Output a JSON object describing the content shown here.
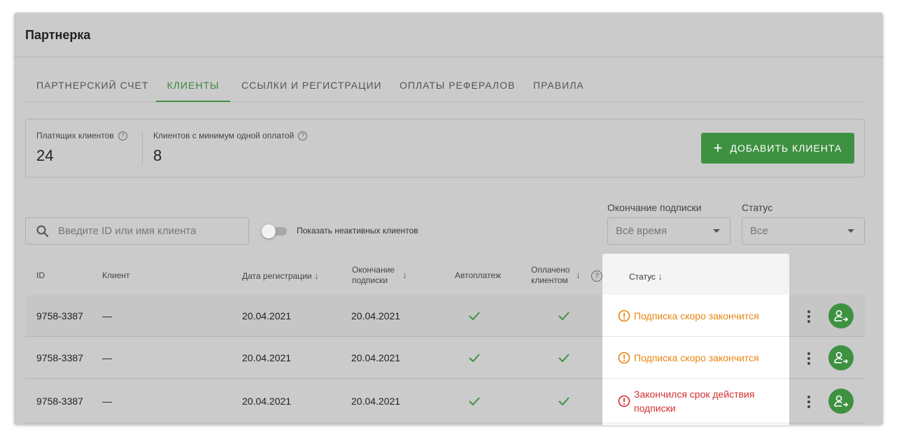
{
  "page": {
    "title": "Партнерка"
  },
  "tabs": [
    {
      "label": "ПАРТНЕРСКИЙ СЧЕТ",
      "active": false
    },
    {
      "label": "КЛИЕНТЫ",
      "active": true
    },
    {
      "label": "ССЫЛКИ И РЕГИСТРАЦИИ",
      "active": false
    },
    {
      "label": "ОПЛАТЫ РЕФЕРАЛОВ",
      "active": false
    },
    {
      "label": "ПРАВИЛА",
      "active": false
    }
  ],
  "stats": {
    "paying": {
      "label": "Платящих клиентов",
      "value": "24"
    },
    "one_payment": {
      "label": "Клиентов с минимум одной оплатой",
      "value": "8"
    }
  },
  "actions": {
    "add_client": "ДОБАВИТЬ КЛИЕНТА"
  },
  "filters": {
    "search_placeholder": "Введите ID или имя клиента",
    "toggle_label": "Показать неактивных клиентов",
    "subscription_end": {
      "label": "Окончание подписки",
      "value": "Всё время"
    },
    "status": {
      "label": "Статус",
      "value": "Все"
    }
  },
  "table": {
    "headers": {
      "id": "ID",
      "client": "Клиент",
      "reg_date": "Дата регистрации",
      "sub_end_1": "Окончание",
      "sub_end_2": "подписки",
      "autopay": "Автоплатеж",
      "paid_1": "Оплачено",
      "paid_2": "клиентом",
      "status": "Статус"
    },
    "rows": [
      {
        "id": "9758-3387",
        "client": "—",
        "reg_date": "20.04.2021",
        "sub_end": "20.04.2021",
        "autopay": true,
        "paid": true,
        "status_1": "Подписка скоро закончится",
        "status_2": "",
        "status_kind": "warning"
      },
      {
        "id": "9758-3387",
        "client": "—",
        "reg_date": "20.04.2021",
        "sub_end": "20.04.2021",
        "autopay": true,
        "paid": true,
        "status_1": "Подписка скоро закончится",
        "status_2": "",
        "status_kind": "warning"
      },
      {
        "id": "9758-3387",
        "client": "—",
        "reg_date": "20.04.2021",
        "sub_end": "20.04.2021",
        "autopay": true,
        "paid": true,
        "status_1": "Закончился срок действия",
        "status_2": "подписки",
        "status_kind": "error"
      }
    ]
  },
  "colors": {
    "accent": "#3f9142",
    "warning": "#e8850c",
    "error": "#d32f2f"
  }
}
